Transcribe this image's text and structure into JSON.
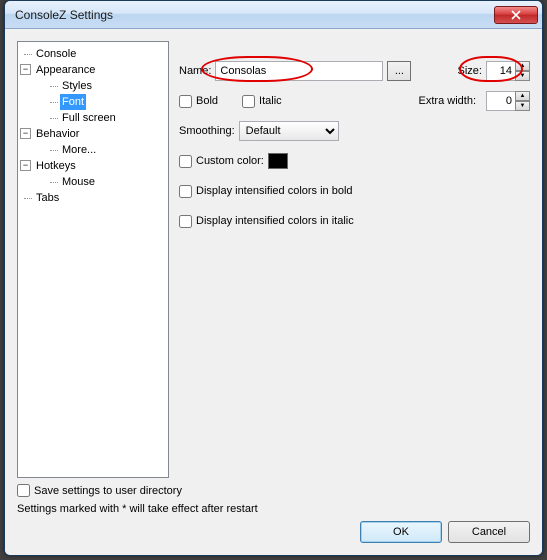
{
  "window": {
    "title": "ConsoleZ Settings"
  },
  "tree": {
    "console": "Console",
    "appearance": "Appearance",
    "styles": "Styles",
    "font": "Font",
    "fullscreen": "Full screen",
    "behavior": "Behavior",
    "more": "More...",
    "hotkeys": "Hotkeys",
    "mouse": "Mouse",
    "tabs": "Tabs"
  },
  "form": {
    "nameLabel": "Name:",
    "nameValue": "Consolas",
    "browse": "...",
    "sizeLabel": "Size:",
    "sizeValue": "14",
    "bold": "Bold",
    "italic": "Italic",
    "extraWidthLabel": "Extra width:",
    "extraWidthValue": "0",
    "smoothingLabel": "Smoothing:",
    "smoothingValue": "Default",
    "customColor": "Custom color:",
    "intBold": "Display intensified colors in bold",
    "intItalic": "Display intensified colors in italic"
  },
  "footer": {
    "saveUserDir": "Save settings to user directory",
    "hint": "Settings marked with * will take effect after restart",
    "ok": "OK",
    "cancel": "Cancel"
  }
}
